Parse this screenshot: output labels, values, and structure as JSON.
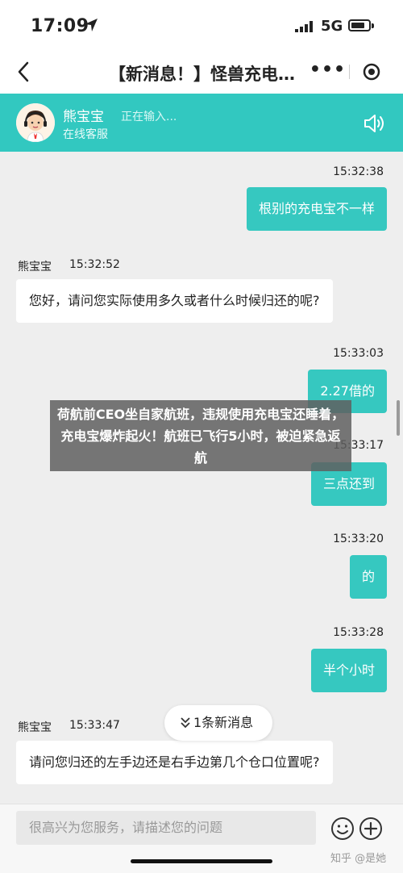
{
  "status_bar": {
    "time": "17:09",
    "network": "5G"
  },
  "nav": {
    "title": "【新消息！】怪兽充电…",
    "more_label": "•••"
  },
  "agent": {
    "name": "熊宝宝",
    "typing": "正在输入...",
    "status": "在线客服"
  },
  "messages": [
    {
      "side": "right",
      "time": "15:32:38",
      "text": "根别的充电宝不一样"
    },
    {
      "side": "left",
      "sender": "熊宝宝",
      "time": "15:32:52",
      "text": "您好，请问您实际使用多久或者什么时候归还的呢?"
    },
    {
      "side": "right",
      "time": "15:33:03",
      "text": "2.27借的"
    },
    {
      "side": "right",
      "time": "15:33:17",
      "text": "三点还到"
    },
    {
      "side": "right",
      "time": "15:33:20",
      "text": "的"
    },
    {
      "side": "right",
      "time": "15:33:28",
      "text": "半个小时"
    },
    {
      "side": "left",
      "sender": "熊宝宝",
      "time": "15:33:47",
      "text": "请问您归还的左手边还是右手边第几个仓口位置呢?"
    }
  ],
  "new_message": {
    "label": "1条新消息"
  },
  "input": {
    "placeholder": "很高兴为您服务，请描述您的问题"
  },
  "overlay_caption": "荷航前CEO坐自家航班，违规使用充电宝还睡着，充电宝爆炸起火！航班已飞行5小时，被迫紧急返航",
  "watermark": "知乎 @是她",
  "colors": {
    "accent": "#32c8c0",
    "bubble_out": "#36c8c0",
    "background": "#eeeeee"
  }
}
